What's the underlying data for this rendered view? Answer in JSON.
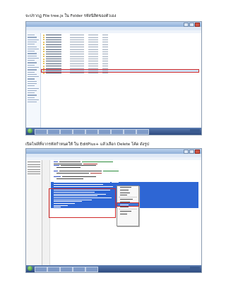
{
  "step1": {
    "caption": "จะปรากฏ File tree.js ใน Folder รหัสนิสิตของตัวเอง"
  },
  "step2": {
    "caption": "เปิดไฟล์ที่จากรหัสกำหนดให้ ใน EditPlus+ แล้วเลือก Delete โค้ด ดังรูป"
  }
}
